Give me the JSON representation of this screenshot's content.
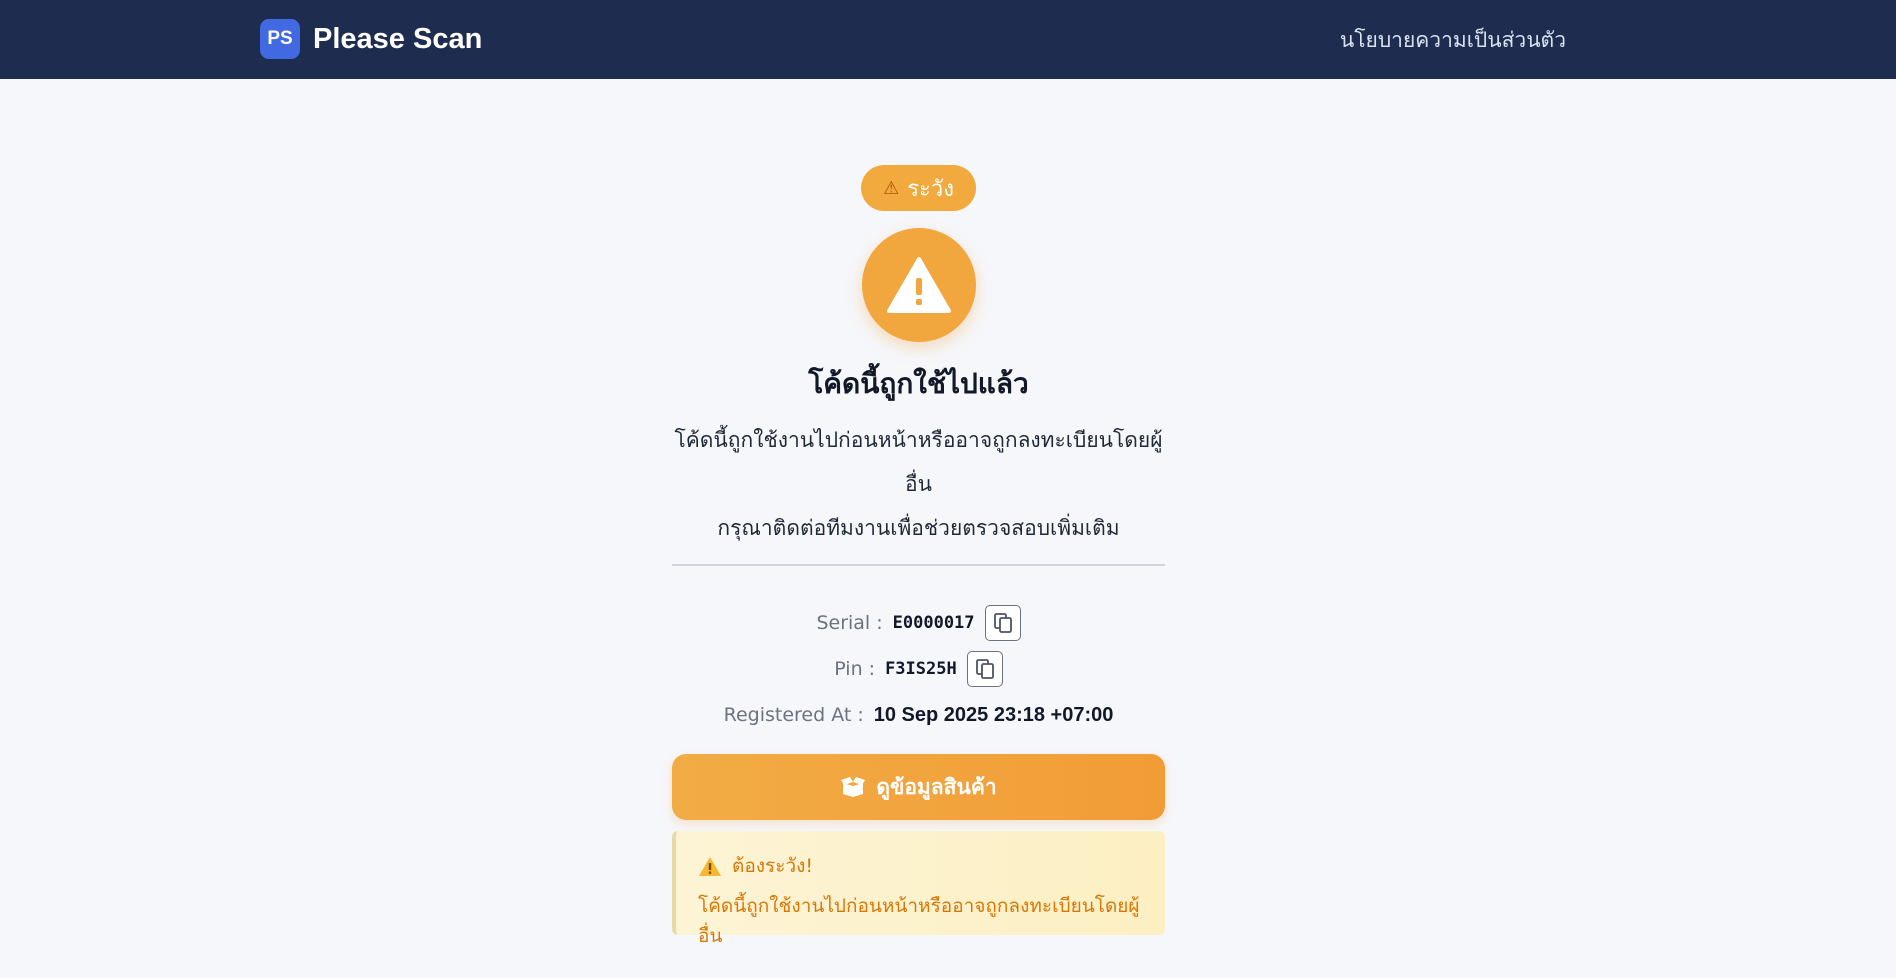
{
  "header": {
    "logo_text": "PS",
    "app_name": "Please Scan",
    "nav_link": "นโยบายความเป็นส่วนตัว"
  },
  "status": {
    "badge_label": "ระวัง",
    "badge_icon": "warning-icon",
    "main_icon": "warning-triangle-icon",
    "accent_color": "#f2a63e",
    "title": "โค้ดนี้ถูกใช้ไปแล้ว",
    "description_line1": "โค้ดนี้ถูกใช้งานไปก่อนหน้าหรืออาจถูกลงทะเบียนโดยผู้อื่น",
    "description_line2": "กรุณาติดต่อทีมงานเพื่อช่วยตรวจสอบเพิ่มเติม"
  },
  "details": {
    "serial_label": "Serial :",
    "serial_value": "E0000017",
    "pin_label": "Pin :",
    "pin_value": "F3IS25H",
    "registered_label": "Registered At :",
    "registered_value": "10 Sep 2025 23:18 +07:00"
  },
  "action": {
    "view_product_label": "ดูข้อมูลสินค้า",
    "view_product_icon": "box-open-icon"
  },
  "alert": {
    "title": "ต้องระวัง!",
    "message": "โค้ดนี้ถูกใช้งานไปก่อนหน้าหรืออาจถูกลงทะเบียนโดยผู้อื่น",
    "color": "#d97706"
  }
}
